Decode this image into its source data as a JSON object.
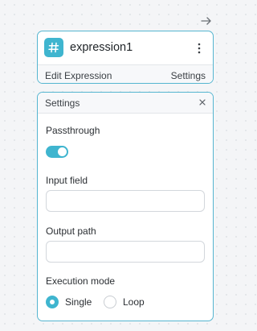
{
  "canvas": {
    "arrow_icon": "arrow-right-icon"
  },
  "node": {
    "icon": "hash-icon",
    "title": "expression1",
    "menu_icon": "vertical-dots-icon",
    "footer": {
      "edit_label": "Edit Expression",
      "settings_label": "Settings"
    }
  },
  "settings_panel": {
    "title": "Settings",
    "close_icon": "close-icon",
    "passthrough": {
      "label": "Passthrough",
      "enabled": true
    },
    "input_field": {
      "label": "Input field",
      "value": ""
    },
    "output_path": {
      "label": "Output path",
      "value": ""
    },
    "execution_mode": {
      "label": "Execution mode",
      "options": [
        "Single",
        "Loop"
      ],
      "selected": "Single"
    }
  },
  "colors": {
    "accent": "#3fb5cf",
    "border_accent": "#55b5d0",
    "canvas_bg": "#f4f5f7"
  }
}
